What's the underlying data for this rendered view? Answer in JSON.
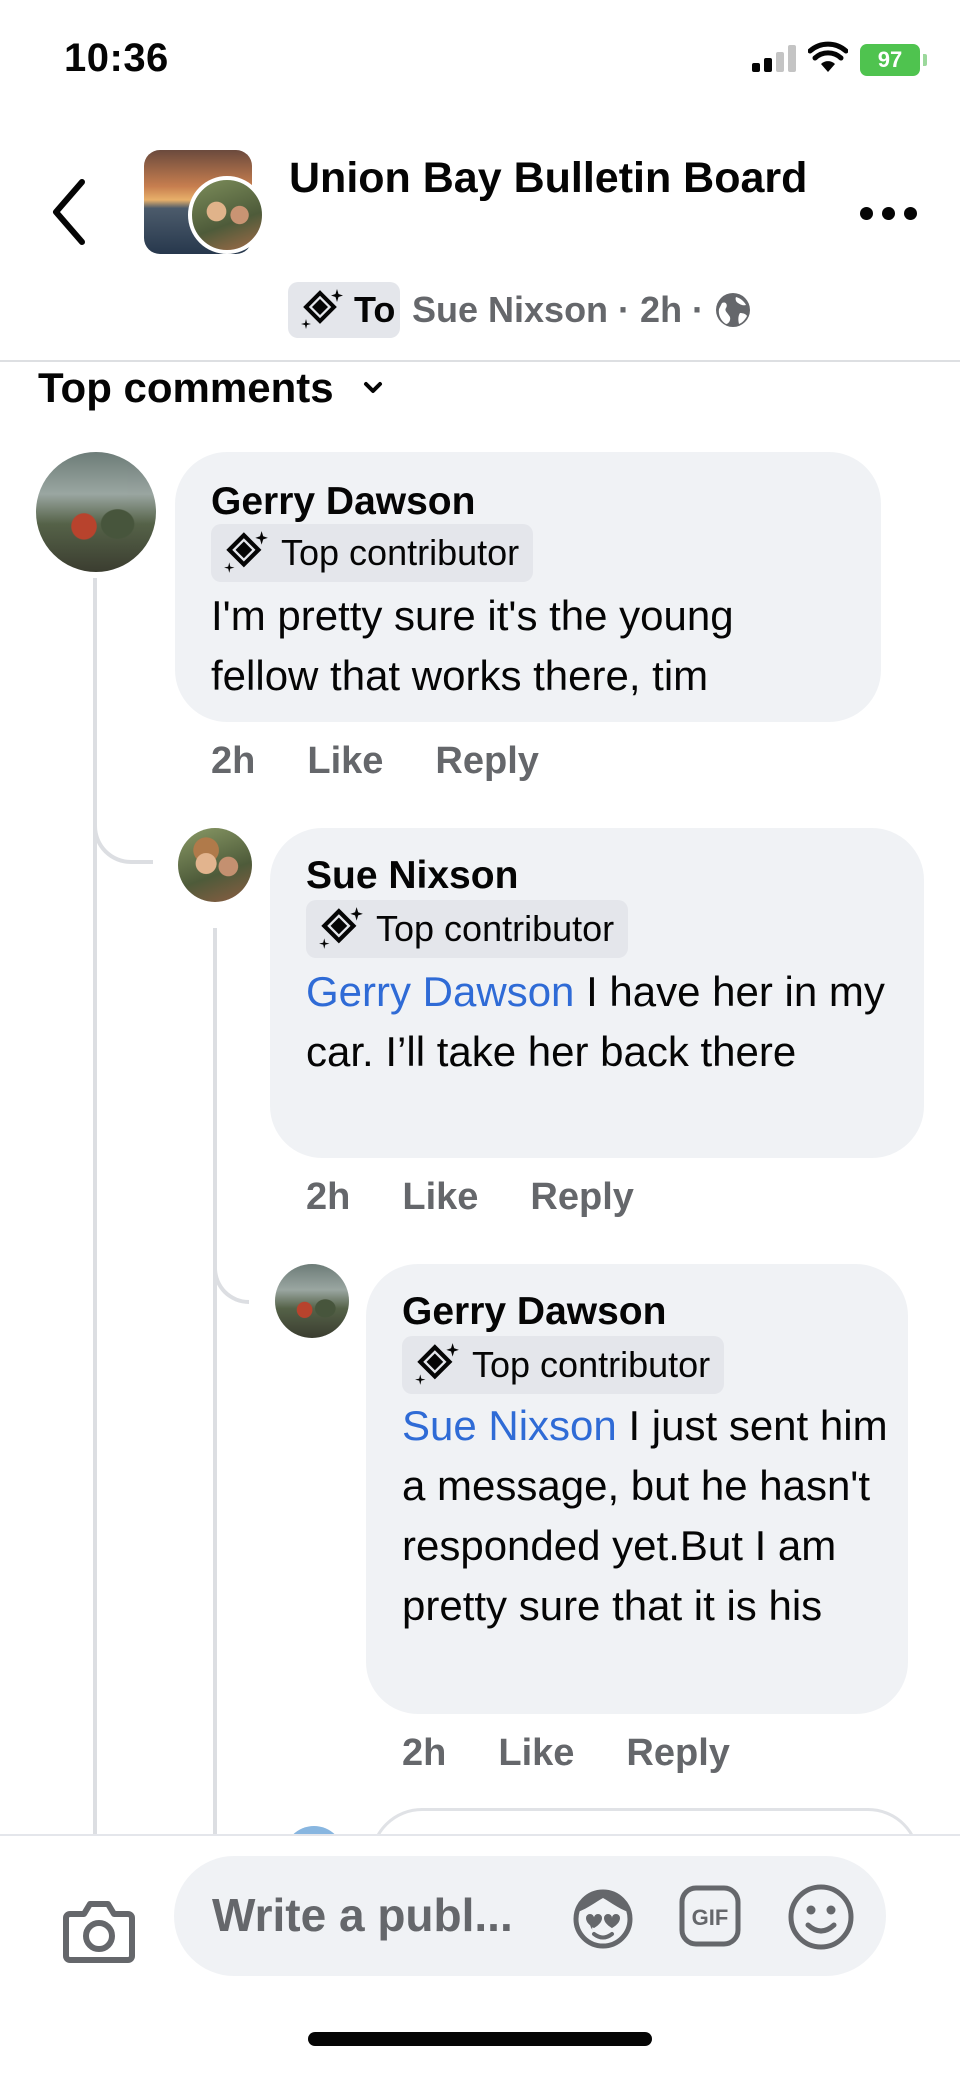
{
  "status_bar": {
    "time": "10:36",
    "battery": "97"
  },
  "header": {
    "group_name": "Union Bay Bulletin Board",
    "badge_short": "To",
    "poster": "Sue Nixson",
    "meta": "Sue Nixson · 2h ·",
    "icons": [
      "back-icon",
      "more-icon",
      "globe-icon",
      "top-contributor-icon"
    ]
  },
  "comments_filter": {
    "label": "Top comments"
  },
  "comments": [
    {
      "author": "Gerry Dawson",
      "badge": "Top contributor",
      "mention": "",
      "text": "I'm pretty sure it's the young fellow that works there, tim",
      "time": "2h",
      "like": "Like",
      "reply": "Reply"
    },
    {
      "author": "Sue Nixson",
      "badge": "Top contributor",
      "mention": "Gerry Dawson",
      "text": "I have her in my car. I’ll take her back there",
      "time": "2h",
      "like": "Like",
      "reply": "Reply"
    },
    {
      "author": "Gerry Dawson",
      "badge": "Top contributor",
      "mention": "Sue Nixson",
      "text": "I just sent him a message, but he hasn't responded yet.But I am pretty sure that it is his",
      "time": "2h",
      "like": "Like",
      "reply": "Reply"
    }
  ],
  "composer": {
    "placeholder": "Write a publ...",
    "icons": [
      "camera-icon",
      "avatar-sticker-icon",
      "gif-icon",
      "emoji-icon"
    ]
  },
  "colors": {
    "mention": "#2f6bd6",
    "bubble": "#f0f2f5",
    "secondary_text": "#65676b",
    "battery": "#4fc34f"
  }
}
